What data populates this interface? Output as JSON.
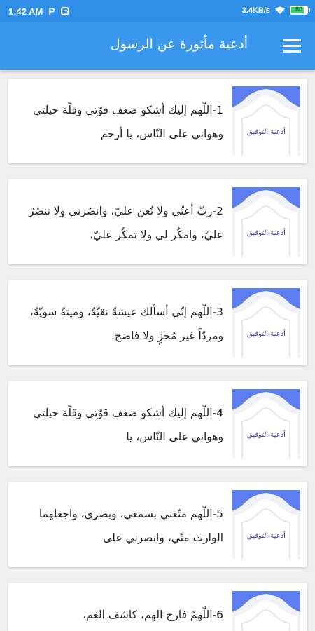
{
  "status_bar": {
    "time": "1:42 AM",
    "app_icons": [
      "paytm-p-icon",
      "instagram-icon"
    ],
    "net_speed": "3.4KB/s",
    "battery_percent": 80,
    "battery_label": "80"
  },
  "app_bar": {
    "title": "أدعية مأثورة عن الرسول",
    "menu_icon": "hamburger-menu-icon"
  },
  "colors": {
    "status_bar": "#2f8fe6",
    "app_bar": "#3a99ef",
    "background": "#efefef",
    "card": "#ffffff",
    "thumb_blue": "#4f8ff0",
    "thumb_purple": "#7b63e8"
  },
  "thumbnail": {
    "label": "أدعية التوفيق"
  },
  "items": [
    {
      "text": "1-اللّهم إليك أشكو ضعف قوّتي وقلّة حيلتي وهواني على النّاس، يا أرحم"
    },
    {
      "text": "2-ربّ أعنّي ولا تُعن عليّ، وانصُرني ولا تنصُرْ عليّ، وامكُر لي ولا تمكُر عليّ،"
    },
    {
      "text": "3-اللّهم إنّي أسألك عيشةً نقيّةً، وميتةً سويّةً، ومردّاً غير مُخزٍ ولا فاضح."
    },
    {
      "text": "4-اللّهم إليك أشكو ضعف قوّتي وقلّة حيلتي وهواني على النّاس، يا"
    },
    {
      "text": "5-اللّهم متّعني بسمعي، وبصري، واجعلهما الوارث منّي، وانصرني على"
    },
    {
      "text": "6-اللّهمّ فارج الهم، كاشف الغم،"
    }
  ]
}
